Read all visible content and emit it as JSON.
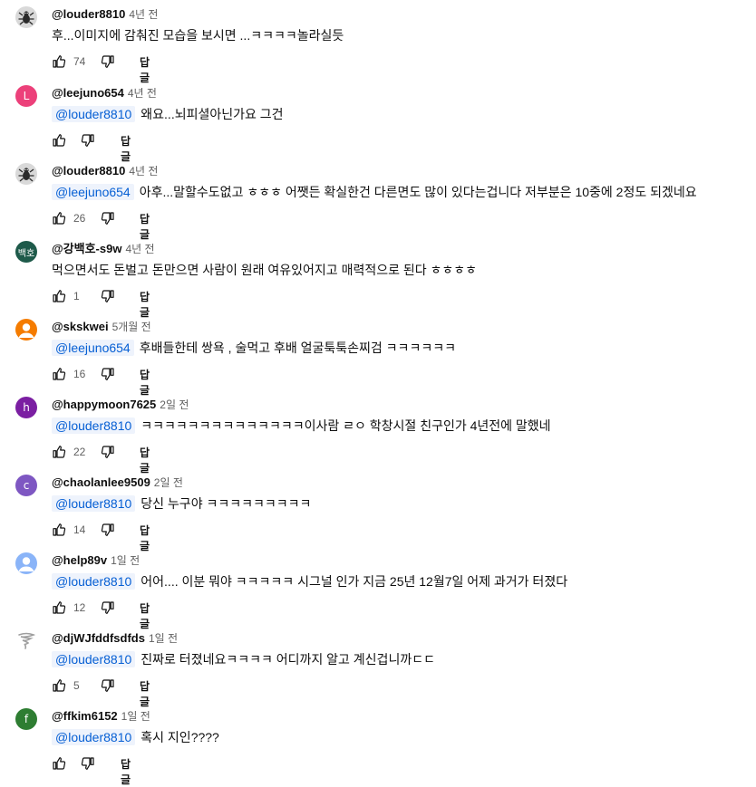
{
  "reply_label": "답글",
  "comments": [
    {
      "avatar_type": "image",
      "avatar_icon": "bug-image-icon",
      "handle": "@louder8810",
      "time": "4년 전",
      "mention": "",
      "text": "후...이미지에 감춰진 모습을 보시면 ...ㅋㅋㅋㅋ놀라실듯",
      "likes": "74"
    },
    {
      "avatar_type": "letter",
      "avatar_letter": "L",
      "avatar_color": "#ec407a",
      "handle": "@leejuno654",
      "time": "4년 전",
      "mention": "@louder8810",
      "text": "왜요...뇌피셜아닌가요 그건",
      "likes": ""
    },
    {
      "avatar_type": "image",
      "avatar_icon": "bug-image-icon",
      "handle": "@louder8810",
      "time": "4년 전",
      "mention": "@leejuno654",
      "text": "아후...말할수도없고 ㅎㅎㅎ 어쨋든 확실한건 다른면도 많이 있다는겁니다 저부분은 10중에 2정도 되겠네요",
      "likes": "26"
    },
    {
      "avatar_type": "letter",
      "avatar_letter": "백호",
      "avatar_color": "#1e5a4a",
      "handle": "@강백호-s9w",
      "time": "4년 전",
      "mention": "",
      "text": "먹으면서도 돈벌고 돈만으면 사람이 원래 여유있어지고 매력적으로 된다 ㅎㅎㅎㅎ",
      "likes": "1"
    },
    {
      "avatar_type": "person",
      "avatar_color": "#f57c00",
      "handle": "@skskwei",
      "time": "5개월 전",
      "mention": "@leejuno654",
      "text": "후배들한테 쌍욕 , 술먹고 후배 얼굴툭툭손찌검  ㅋㅋㅋㅋㅋㅋ",
      "likes": "16"
    },
    {
      "avatar_type": "letter",
      "avatar_letter": "h",
      "avatar_color": "#7b1fa2",
      "handle": "@happymoon7625",
      "time": "2일 전",
      "mention": "@louder8810",
      "text": "ㅋㅋㅋㅋㅋㅋㅋㅋㅋㅋㅋㅋㅋㅋ이사람 ㄹㅇ 학창시절 친구인가 4년전에 말했네",
      "likes": "22"
    },
    {
      "avatar_type": "letter",
      "avatar_letter": "c",
      "avatar_color": "#7e57c2",
      "handle": "@chaolanlee9509",
      "time": "2일 전",
      "mention": "@louder8810",
      "text": "당신 누구야 ㅋㅋㅋㅋㅋㅋㅋㅋㅋ",
      "likes": "14"
    },
    {
      "avatar_type": "person",
      "avatar_color": "#8ab4f8",
      "handle": "@help89v",
      "time": "1일 전",
      "mention": "@louder8810",
      "text": "어어.... 이분 뭐야 ㅋㅋㅋㅋㅋ  시그널 인가  지금 25년 12월7일  어제 과거가 터졌다",
      "likes": "12"
    },
    {
      "avatar_type": "image",
      "avatar_icon": "tornado-image-icon",
      "handle": "@djWJfddfsdfds",
      "time": "1일 전",
      "mention": "@louder8810",
      "text": "진짜로 터졌네요ㅋㅋㅋㅋ 어디까지 알고 계신겁니까ㄷㄷ",
      "likes": "5"
    },
    {
      "avatar_type": "letter",
      "avatar_letter": "f",
      "avatar_color": "#2e7d32",
      "handle": "@ffkim6152",
      "time": "1일 전",
      "mention": "@louder8810",
      "text": "혹시 지인????",
      "likes": ""
    }
  ]
}
